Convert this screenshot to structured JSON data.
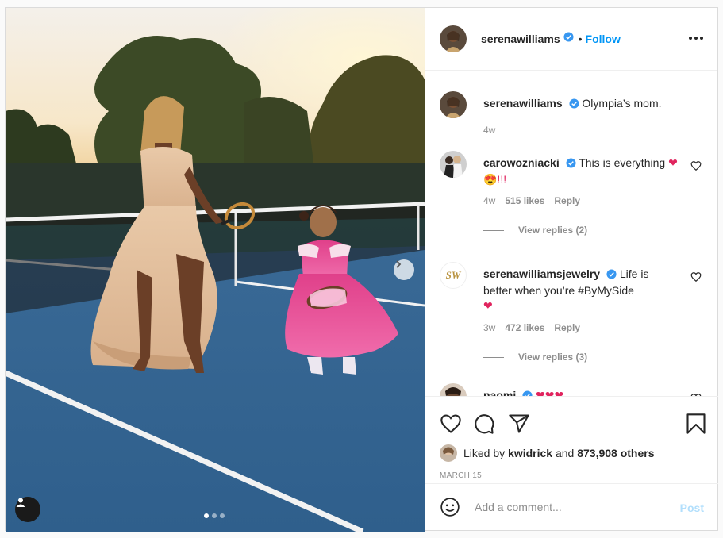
{
  "header": {
    "username": "serenawilliams",
    "bullet": "•",
    "follow_label": "Follow"
  },
  "caption": {
    "username": "serenawilliams",
    "text": "Olympia’s mom.",
    "time": "4w"
  },
  "comments": [
    {
      "username": "carowozniacki",
      "text": "This is everything",
      "emoji": "❤😍!!!",
      "time": "4w",
      "likes": "515 likes",
      "reply_label": "Reply",
      "view_replies": "View replies (2)"
    },
    {
      "username": "serenawilliamsjewelry",
      "avatar_text": "SW",
      "text_before": "Life is better when you’re",
      "hashtag": "#ByMySide",
      "emoji": "❤",
      "time": "3w",
      "likes": "472 likes",
      "reply_label": "Reply",
      "view_replies": "View replies (3)"
    },
    {
      "username": "naomi",
      "emoji": "❤❤❤"
    }
  ],
  "likes": {
    "prefix": "Liked by",
    "user": "kwidrick",
    "connector": "and",
    "others": "873,908 others"
  },
  "date": "MARCH 15",
  "add_comment": {
    "placeholder": "Add a comment...",
    "post_label": "Post"
  },
  "carousel": {
    "current": 1,
    "total": 3
  },
  "colors": {
    "follow": "#0095f6",
    "verified": "#3897f0",
    "post_disabled": "#b2dffc",
    "hashtag": "#00376b",
    "heart_emoji": "#e0245e"
  },
  "icons": [
    "like-icon",
    "comment-icon",
    "share-icon",
    "save-icon",
    "emoji-icon",
    "more-icon",
    "user-tag-icon",
    "chevron-right-icon",
    "verified-icon"
  ]
}
